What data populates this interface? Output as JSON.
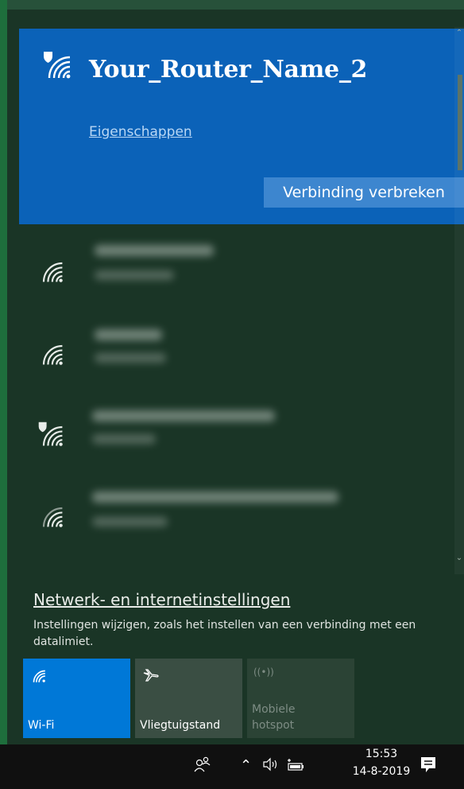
{
  "connected_network": {
    "name": "Your_Router_Name_2",
    "properties_link": "Eigenschappen",
    "disconnect_button": "Verbinding verbreken"
  },
  "networks": [
    {
      "secured_badge": false,
      "status_blurred": true
    },
    {
      "secured_badge": false,
      "status_blurred": true
    },
    {
      "secured_badge": true,
      "status_blurred": true
    },
    {
      "secured_badge": false,
      "status_blurred": true
    }
  ],
  "settings": {
    "link": "Netwerk- en internetinstellingen",
    "description": "Instellingen wijzigen, zoals het instellen van een verbinding met een datalimiet."
  },
  "quick_actions": [
    {
      "label": "Wi-Fi",
      "icon": "wifi-icon",
      "active": true
    },
    {
      "label": "Vliegtuigstand",
      "icon": "airplane-icon",
      "active": false
    },
    {
      "label": "Mobiele hotspot",
      "icon": "hotspot-icon",
      "active": false,
      "disabled": true
    }
  ],
  "taskbar": {
    "time": "15:53",
    "date": "14-8-2019"
  },
  "colors": {
    "accent": "#0b62b8",
    "panel_bg": "#1a3526",
    "wifi_tile": "#0078d7"
  }
}
